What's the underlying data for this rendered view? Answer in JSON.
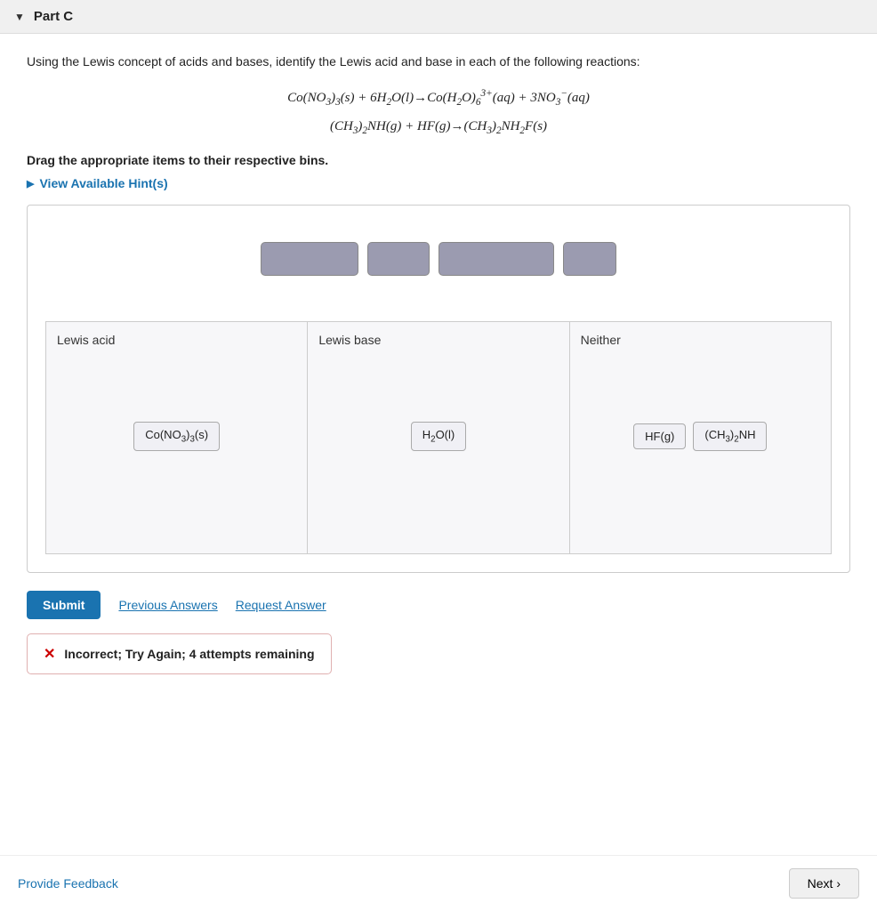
{
  "part_header": {
    "chevron": "▼",
    "title": "Part C"
  },
  "instructions": "Using the Lewis concept of acids and bases, identify the Lewis acid and base in each of the following reactions:",
  "equations": [
    "Co(NO₃)₃(s) + 6H₂O(l) → Co(H₂O)₆³⁺(aq) + 3NO₃⁻(aq)",
    "(CH₃)₂NH(g) + HF(g) → (CH₃)₂NH₂F(s)"
  ],
  "drag_instruction": "Drag the appropriate items to their respective bins.",
  "hint_label": "View Available Hint(s)",
  "drag_items": [
    {
      "id": "item1",
      "size": "lg"
    },
    {
      "id": "item2",
      "size": "md"
    },
    {
      "id": "item3",
      "size": "xl"
    },
    {
      "id": "item4",
      "size": "sm"
    }
  ],
  "bins": [
    {
      "id": "lewis-acid",
      "label": "Lewis acid",
      "items": [
        "Co(NO₃)₃(s)"
      ]
    },
    {
      "id": "lewis-base",
      "label": "Lewis base",
      "items": [
        "H₂O(l)"
      ]
    },
    {
      "id": "neither",
      "label": "Neither",
      "items": [
        "HF(g)",
        "(CH₃)₂NH"
      ]
    }
  ],
  "buttons": {
    "submit": "Submit",
    "previous_answers": "Previous Answers",
    "request_answer": "Request Answer"
  },
  "result": {
    "icon": "✕",
    "text": "Incorrect; Try Again; 4 attempts remaining"
  },
  "footer": {
    "feedback": "Provide Feedback",
    "next": "Next ›"
  }
}
